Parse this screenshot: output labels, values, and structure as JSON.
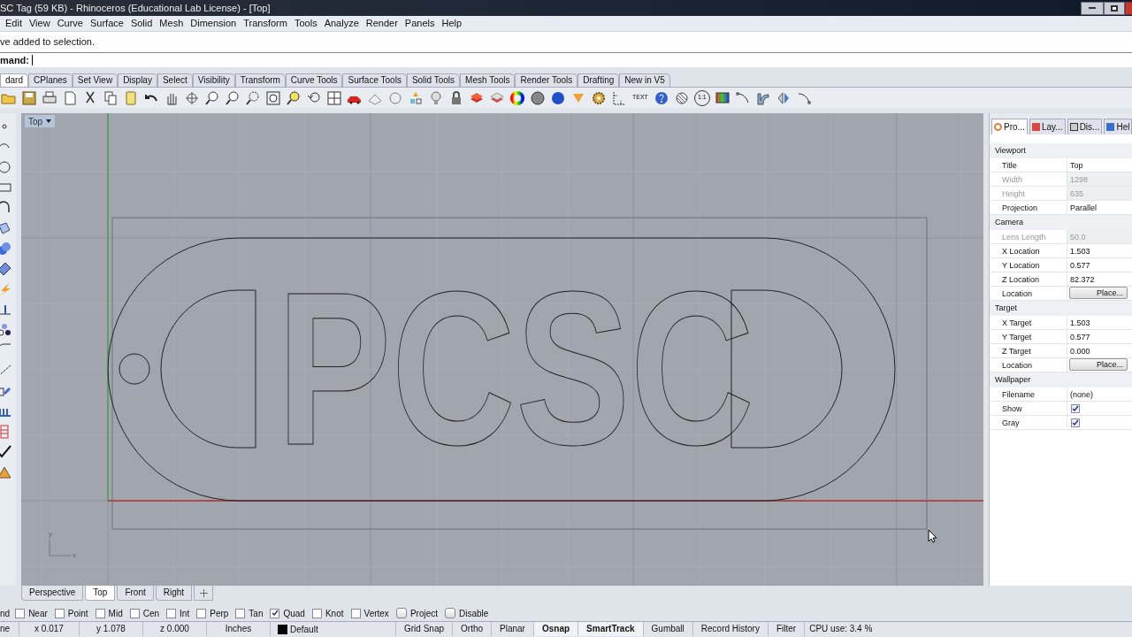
{
  "window": {
    "title": "SC Tag (59 KB) - Rhinoceros (Educational Lab License) - [Top]"
  },
  "menu": [
    "Edit",
    "View",
    "Curve",
    "Surface",
    "Solid",
    "Mesh",
    "Dimension",
    "Transform",
    "Tools",
    "Analyze",
    "Render",
    "Panels",
    "Help"
  ],
  "command_history": "ve added to selection.",
  "command_prompt": "mand:",
  "toolbar_tabs": [
    {
      "label": "dard",
      "selected": true
    },
    {
      "label": "CPlanes",
      "selected": false
    },
    {
      "label": "Set View",
      "selected": false
    },
    {
      "label": "Display",
      "selected": false
    },
    {
      "label": "Select",
      "selected": false
    },
    {
      "label": "Visibility",
      "selected": false
    },
    {
      "label": "Transform",
      "selected": false
    },
    {
      "label": "Curve Tools",
      "selected": false
    },
    {
      "label": "Surface Tools",
      "selected": false
    },
    {
      "label": "Solid Tools",
      "selected": false
    },
    {
      "label": "Mesh Tools",
      "selected": false
    },
    {
      "label": "Render Tools",
      "selected": false
    },
    {
      "label": "Drafting",
      "selected": false
    },
    {
      "label": "New in V5",
      "selected": false
    }
  ],
  "toolbar": {
    "text_tool": "TEXT",
    "zoom_ratio": "1:1"
  },
  "viewport": {
    "title": "Top",
    "model_text": "PCSC",
    "axis_x": "x",
    "axis_y": "y"
  },
  "viewport_tabs": [
    {
      "label": "Perspective",
      "selected": false
    },
    {
      "label": "Top",
      "selected": true
    },
    {
      "label": "Front",
      "selected": false
    },
    {
      "label": "Right",
      "selected": false
    }
  ],
  "panel": {
    "tabs": [
      {
        "label": "Pro...",
        "selected": true
      },
      {
        "label": "Lay...",
        "selected": false
      },
      {
        "label": "Dis...",
        "selected": false
      },
      {
        "label": "Hel",
        "selected": false
      }
    ],
    "sections": [
      {
        "title": "Viewport",
        "rows": [
          {
            "label": "Title",
            "value": "Top",
            "kind": "text",
            "disabled": false
          },
          {
            "label": "Width",
            "value": "1298",
            "kind": "text",
            "disabled": true
          },
          {
            "label": "Height",
            "value": "635",
            "kind": "text",
            "disabled": true
          },
          {
            "label": "Projection",
            "value": "Parallel",
            "kind": "text",
            "disabled": false
          }
        ]
      },
      {
        "title": "Camera",
        "rows": [
          {
            "label": "Lens Length",
            "value": "50.0",
            "kind": "text",
            "disabled": true
          },
          {
            "label": "X Location",
            "value": "1.503",
            "kind": "text",
            "disabled": false
          },
          {
            "label": "Y Location",
            "value": "0.577",
            "kind": "text",
            "disabled": false
          },
          {
            "label": "Z Location",
            "value": "82.372",
            "kind": "text",
            "disabled": false
          },
          {
            "label": "Location",
            "value": "Place...",
            "kind": "button",
            "disabled": false
          }
        ]
      },
      {
        "title": "Target",
        "rows": [
          {
            "label": "X Target",
            "value": "1.503",
            "kind": "text",
            "disabled": false
          },
          {
            "label": "Y Target",
            "value": "0.577",
            "kind": "text",
            "disabled": false
          },
          {
            "label": "Z Target",
            "value": "0.000",
            "kind": "text",
            "disabled": false
          },
          {
            "label": "Location",
            "value": "Place...",
            "kind": "button",
            "disabled": false
          }
        ]
      },
      {
        "title": "Wallpaper",
        "rows": [
          {
            "label": "Filename",
            "value": "(none)",
            "kind": "text",
            "disabled": false
          },
          {
            "label": "Show",
            "kind": "check",
            "checked": true,
            "disabled": false
          },
          {
            "label": "Gray",
            "kind": "check",
            "checked": true,
            "disabled": false
          }
        ]
      }
    ]
  },
  "osnap": {
    "cut_label": "nd",
    "items": [
      {
        "label": "Near",
        "checked": false,
        "kind": "check"
      },
      {
        "label": "Point",
        "checked": false,
        "kind": "check"
      },
      {
        "label": "Mid",
        "checked": false,
        "kind": "check"
      },
      {
        "label": "Cen",
        "checked": false,
        "kind": "check"
      },
      {
        "label": "Int",
        "checked": false,
        "kind": "check"
      },
      {
        "label": "Perp",
        "checked": false,
        "kind": "check"
      },
      {
        "label": "Tan",
        "checked": false,
        "kind": "check"
      },
      {
        "label": "Quad",
        "checked": true,
        "kind": "check"
      },
      {
        "label": "Knot",
        "checked": false,
        "kind": "check"
      },
      {
        "label": "Vertex",
        "checked": false,
        "kind": "check"
      },
      {
        "label": "Project",
        "checked": false,
        "kind": "toggle"
      },
      {
        "label": "Disable",
        "checked": false,
        "kind": "toggle"
      }
    ]
  },
  "status_bar": {
    "cut_cell": "ne",
    "x": "x 0.017",
    "y": "y 1.078",
    "z": "z 0.000",
    "units": "Inches",
    "layer": "Default",
    "toggles": [
      {
        "label": "Grid Snap",
        "on": false
      },
      {
        "label": "Ortho",
        "on": false
      },
      {
        "label": "Planar",
        "on": false
      },
      {
        "label": "Osnap",
        "on": true
      },
      {
        "label": "SmartTrack",
        "on": true
      },
      {
        "label": "Gumball",
        "on": false
      },
      {
        "label": "Record History",
        "on": false
      },
      {
        "label": "Filter",
        "on": false
      }
    ],
    "cpu": "CPU use: 3.4 %"
  }
}
